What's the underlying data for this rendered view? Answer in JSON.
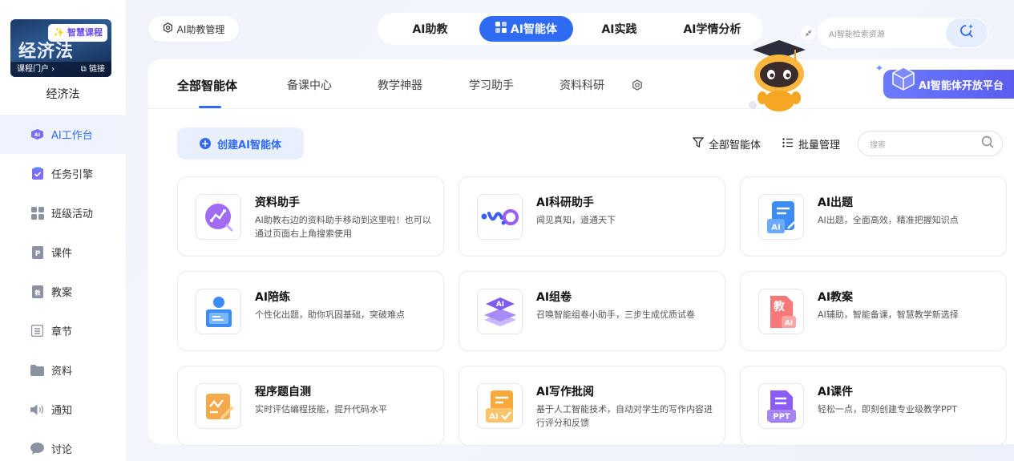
{
  "sidebar": {
    "course_card": {
      "badge": "✨ 智慧课程",
      "big_title": "经济法",
      "portal": "课程门户 ›",
      "link": "⧉ 链接"
    },
    "course_name": "经济法",
    "items": [
      {
        "label": "AI工作台",
        "icon": "ai-workbench-icon",
        "active": true
      },
      {
        "label": "任务引擎",
        "icon": "task-clipboard-icon"
      },
      {
        "label": "班级活动",
        "icon": "grid-icon"
      },
      {
        "label": "课件",
        "icon": "courseware-icon"
      },
      {
        "label": "教案",
        "icon": "lesson-plan-icon"
      },
      {
        "label": "章节",
        "icon": "chapter-list-icon"
      },
      {
        "label": "资料",
        "icon": "folder-icon"
      },
      {
        "label": "通知",
        "icon": "speaker-icon"
      },
      {
        "label": "讨论",
        "icon": "chat-bubble-icon"
      }
    ]
  },
  "header": {
    "manage_label": "AI助教管理",
    "tabs": [
      {
        "label": "AI助教"
      },
      {
        "label": "AI智能体",
        "active": true
      },
      {
        "label": "AI实践"
      },
      {
        "label": "AI学情分析"
      }
    ],
    "search_placeholder": "AI智能检索资源"
  },
  "panel": {
    "categories": [
      "全部智能体",
      "备课中心",
      "教学神器",
      "学习助手",
      "资料科研"
    ],
    "open_platform": "AI智能体开放平台",
    "create_label": "创建AI智能体",
    "filter_label": "全部智能体",
    "batch_label": "批量管理",
    "search_placeholder": "搜索",
    "cards": [
      {
        "title": "资料助手",
        "desc": "AI助教右边的资料助手移动到这里啦！也可以通过页面右上角搜索使用",
        "icon": "data-assistant-icon"
      },
      {
        "title": "AI科研助手",
        "desc": "闻见真知，道通天下",
        "icon": "research-assistant-icon"
      },
      {
        "title": "AI出题",
        "desc": "AI出题，全面高效，精准把握知识点",
        "icon": "question-gen-icon"
      },
      {
        "title": "AI陪练",
        "desc": "个性化出题，助你巩固基础，突破难点",
        "icon": "practice-partner-icon"
      },
      {
        "title": "AI组卷",
        "desc": "召唤智能组卷小助手，三步生成优质试卷",
        "icon": "paper-assembly-icon"
      },
      {
        "title": "AI教案",
        "desc": "AI辅助，智能备课，智慧教学新选择",
        "icon": "ai-lesson-plan-icon"
      },
      {
        "title": "程序题自测",
        "desc": "实时评估编程技能，提升代码水平",
        "icon": "code-test-icon"
      },
      {
        "title": "AI写作批阅",
        "desc": "基于人工智能技术，自动对学生的写作内容进行评分和反馈",
        "icon": "writing-review-icon"
      },
      {
        "title": "AI课件",
        "desc": "轻松一点，即刻创建专业级教学PPT",
        "icon": "ppt-icon"
      }
    ]
  },
  "colors": {
    "accent": "#2f6bf2",
    "accent_light": "#e9effd",
    "card_border": "#e7eaef"
  }
}
